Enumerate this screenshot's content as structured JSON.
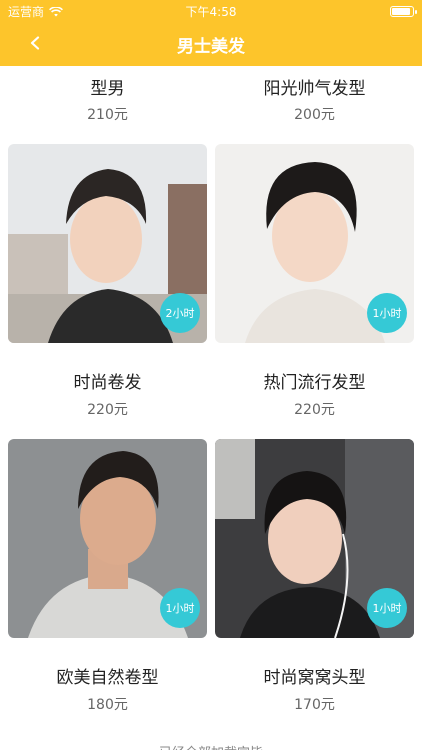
{
  "status_bar": {
    "carrier": "运营商",
    "time": "下午4:58"
  },
  "nav": {
    "title": "男士美发"
  },
  "items": [
    {
      "name": "型男",
      "price": "210元"
    },
    {
      "name": "阳光帅气发型",
      "price": "200元"
    },
    {
      "name": "时尚卷发",
      "price": "220元",
      "duration": "2小时"
    },
    {
      "name": "热门流行发型",
      "price": "220元",
      "duration": "1小时"
    },
    {
      "name": "欧美自然卷型",
      "price": "180元",
      "duration": "1小时"
    },
    {
      "name": "时尚窝窝头型",
      "price": "170元",
      "duration": "1小时"
    }
  ],
  "footer": {
    "text": "已经全部加载完毕"
  },
  "colors": {
    "header": "#FDC52B",
    "badge": "#35C9D6"
  }
}
